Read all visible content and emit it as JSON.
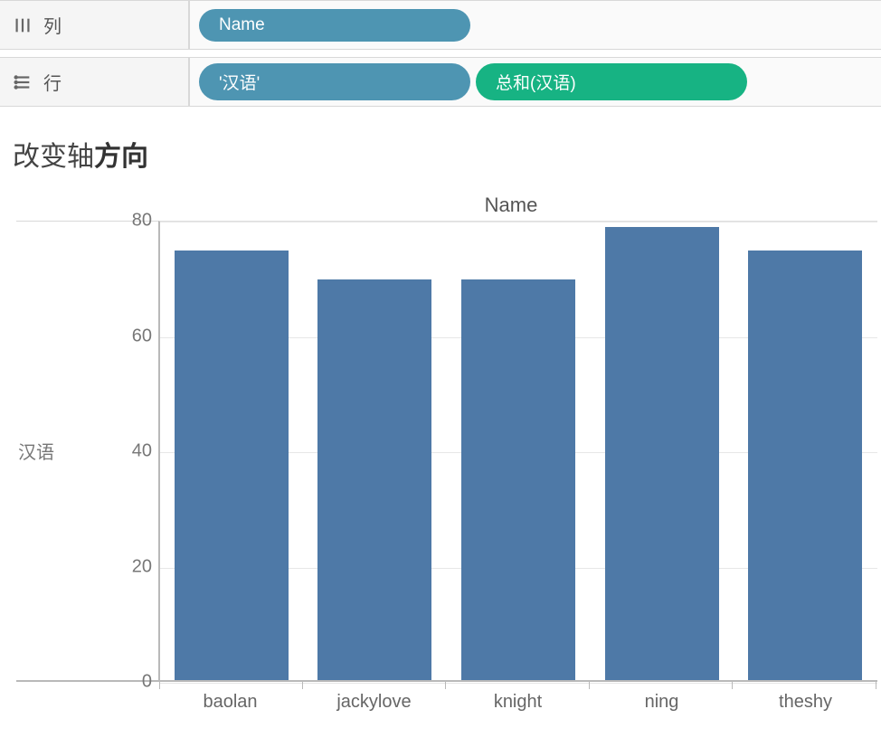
{
  "shelves": {
    "columns": {
      "label": "列",
      "pills": [
        {
          "text": "Name",
          "color": "blue"
        }
      ]
    },
    "rows": {
      "label": "行",
      "pills": [
        {
          "text": "'汉语'",
          "color": "blue"
        },
        {
          "text": "总和(汉语)",
          "color": "green"
        }
      ]
    }
  },
  "title_plain": "改变轴",
  "title_bold": "方向",
  "chart_header": "Name",
  "y_axis_label": "汉语",
  "chart_data": {
    "type": "bar",
    "categories": [
      "baolan",
      "jackylove",
      "knight",
      "ning",
      "theshy"
    ],
    "values": [
      75,
      70,
      70,
      79,
      75
    ],
    "title": "改变轴方向",
    "xlabel": "Name",
    "ylabel": "汉语",
    "ylim": [
      0,
      80
    ],
    "yticks": [
      0,
      20,
      40,
      60,
      80
    ]
  }
}
